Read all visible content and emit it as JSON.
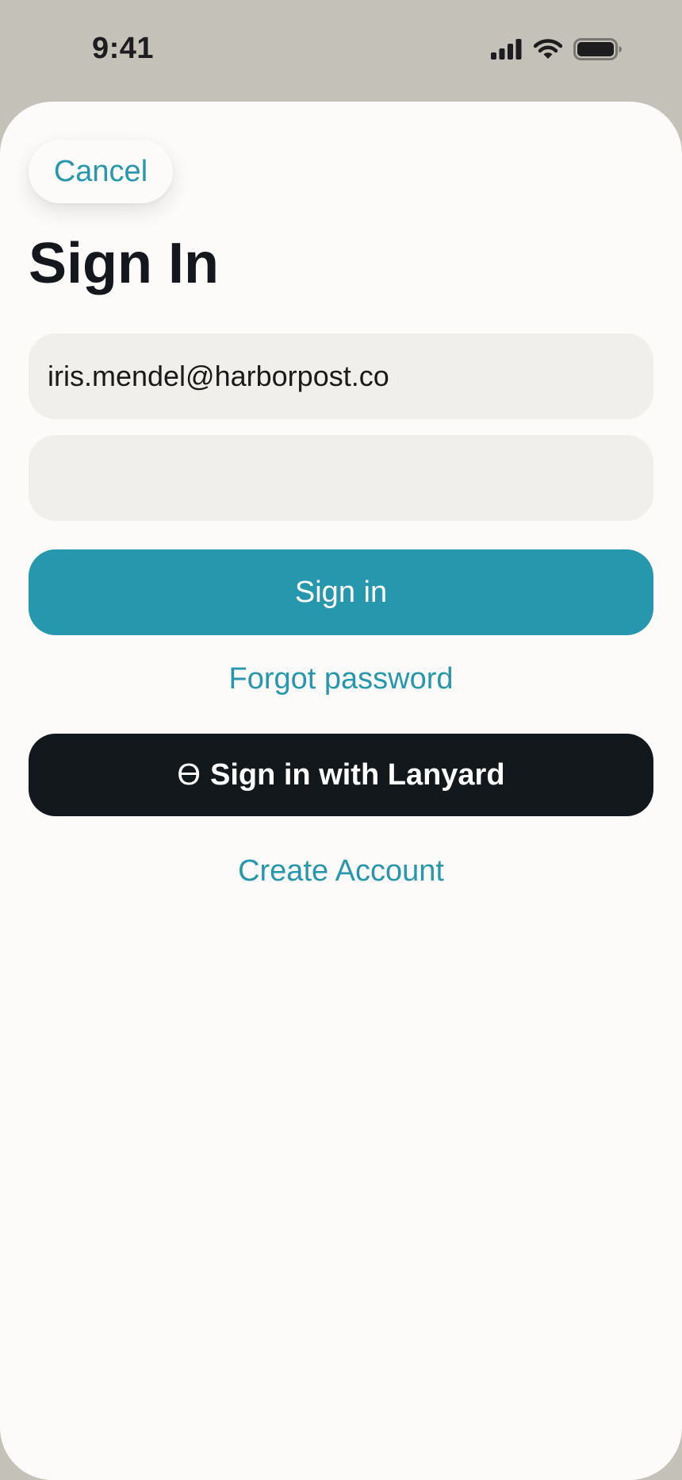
{
  "status_bar": {
    "time": "9:41",
    "icons": [
      "cellular-signal-icon",
      "wifi-icon",
      "battery-icon"
    ]
  },
  "sheet": {
    "cancel_label": "Cancel",
    "title": "Sign In",
    "email_value": "iris.mendel@harborpost.co",
    "password_value": "",
    "sign_in_label": "Sign in",
    "forgot_label": "Forgot password",
    "sso_glyph": "ϴ",
    "sso_label": "Sign in with Lanyard",
    "create_label": "Create Account"
  },
  "colors": {
    "backdrop": "#c4c1b8",
    "sheet": "#fcfbf9",
    "accent": "#2797ae",
    "field": "#f0efec",
    "dark_button": "#13181d",
    "text": "#14181c"
  }
}
